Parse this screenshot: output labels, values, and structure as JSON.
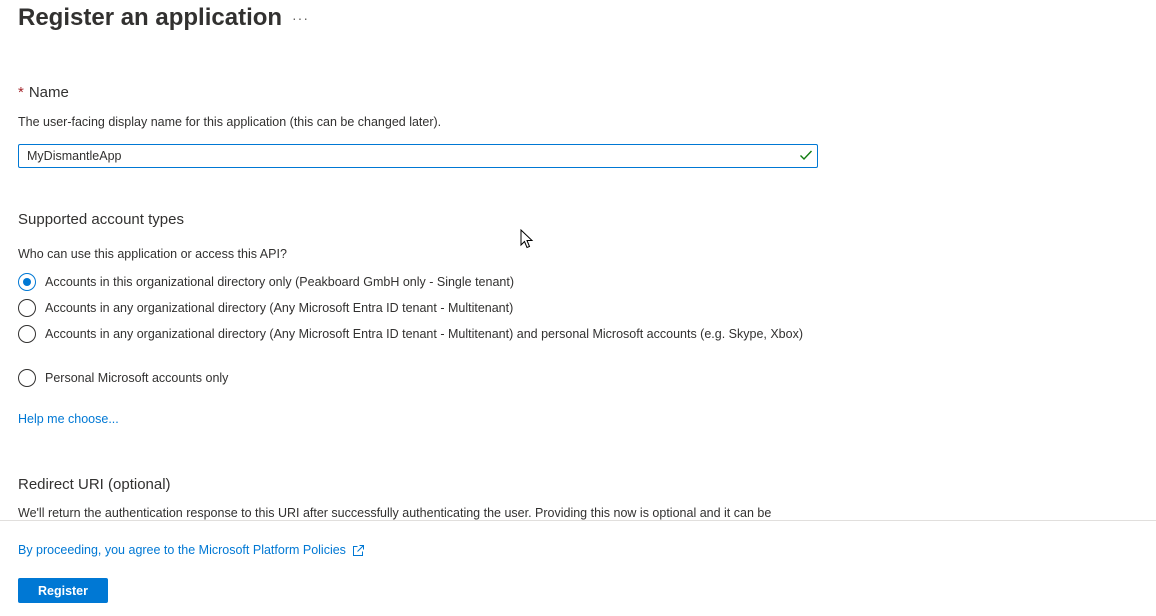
{
  "page": {
    "title": "Register an application",
    "more_icon": "ellipsis-icon"
  },
  "name_section": {
    "label": "Name",
    "required_marker": "*",
    "description": "The user-facing display name for this application (this can be changed later).",
    "input_value": "MyDismantleApp",
    "valid_icon": "checkmark-icon"
  },
  "account_types": {
    "heading": "Supported account types",
    "question": "Who can use this application or access this API?",
    "options": [
      {
        "label": "Accounts in this organizational directory only (Peakboard GmbH only - Single tenant)",
        "selected": true
      },
      {
        "label": "Accounts in any organizational directory (Any Microsoft Entra ID tenant - Multitenant)",
        "selected": false
      },
      {
        "label": "Accounts in any organizational directory (Any Microsoft Entra ID tenant - Multitenant) and personal Microsoft accounts (e.g. Skype, Xbox)",
        "selected": false
      },
      {
        "label": "Personal Microsoft accounts only",
        "selected": false
      }
    ],
    "help_link": "Help me choose..."
  },
  "redirect": {
    "heading": "Redirect URI (optional)",
    "description": "We'll return the authentication response to this URI after successfully authenticating the user. Providing this now is optional and it can be"
  },
  "footer": {
    "policy_link": "By proceeding, you agree to the Microsoft Platform Policies",
    "policy_icon": "external-link-icon",
    "register_label": "Register"
  },
  "colors": {
    "accent": "#0078d4",
    "required": "#a4262c",
    "valid": "#107c10"
  }
}
